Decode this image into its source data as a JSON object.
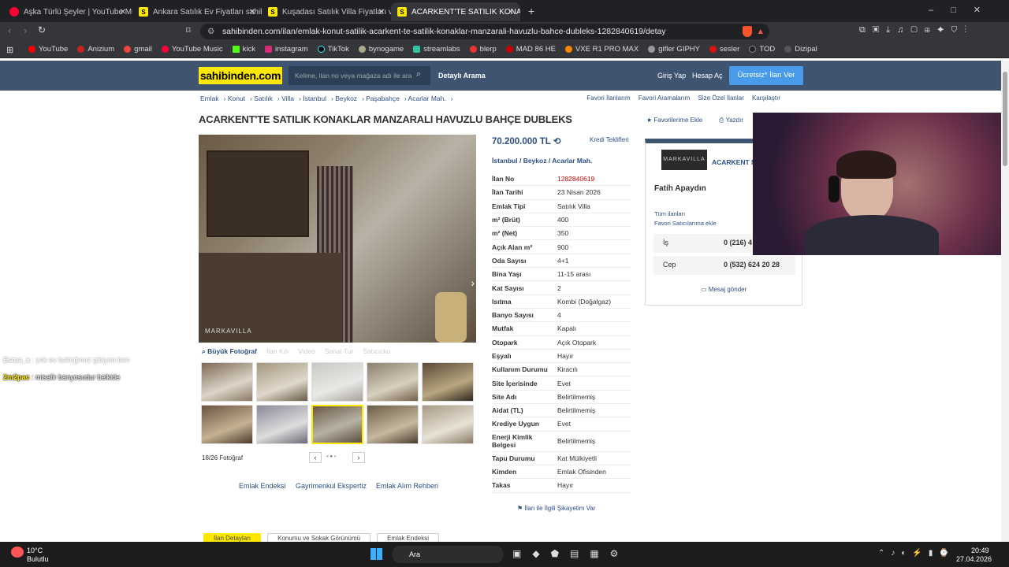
{
  "browser": {
    "tabs": [
      {
        "title": "Aşka Türlü Şeyler | YouTube Music",
        "icon_color": "#ff0033"
      },
      {
        "title": "Ankara Satılık Ev Fiyatları sahibinden.com",
        "icon_color": "#ffe800"
      },
      {
        "title": "Kuşadası Satılık Villa Fiyatları ve Villa",
        "icon_color": "#ffe800"
      },
      {
        "title": "ACARKENT'TE SATILIK KONAKLAR",
        "icon_color": "#ffe800"
      }
    ],
    "url": "sahibinden.com/ilan/emlak-konut-satilik-acarkent-te-satilik-konaklar-manzarali-havuzlu-bahce-dubleks-1282840619/detay",
    "bookmarks": [
      "YouTube",
      "Anizium",
      "gmail",
      "YouTube Music",
      "kick",
      "instagram",
      "TikTok",
      "bynogame",
      "streamlabs",
      "blerp",
      "MAD 86 HE",
      "VXE R1 PRO MAX",
      "gifler GIPHY",
      "sesler",
      "TOD",
      "Dizipal"
    ]
  },
  "site": {
    "logo": "sahibinden.com",
    "search_placeholder": "Kelime, ilan no veya mağaza adı ile ara",
    "detailed_search": "Detaylı Arama",
    "login": "Giriş Yap",
    "register": "Hesap Aç",
    "post_ad": "Ücretsiz* İlan Ver"
  },
  "breadcrumbs": [
    "Emlak",
    "Konut",
    "Satılık",
    "Villa",
    "İstanbul",
    "Beykoz",
    "Paşabahçe",
    "Acarlar Mah."
  ],
  "top_links": [
    "Favori İlanlarım",
    "Favori Aramalarım",
    "Size Özel İlanlar",
    "Karşılaştır"
  ],
  "listing": {
    "title": "ACARKENT'TE SATILIK KONAKLAR MANZARALI HAVUZLU BAHÇE DUBLEKS",
    "favorite": "Favorilerime Ekle",
    "print": "Yazdır",
    "price": "70.200.000 TL",
    "credit": "Kredi Teklifleri",
    "location": [
      "İstanbul",
      "Beykoz",
      "Acarlar Mah."
    ],
    "photo_count": "18/26 Fotoğraf",
    "image_tabs": [
      "Büyük Fotoğraf",
      "İlan Kılı",
      "Video",
      "Sanal Tur",
      "Satıcıcko"
    ],
    "details": [
      {
        "k": "İlan No",
        "v": "1282840619",
        "red": true
      },
      {
        "k": "İlan Tarihi",
        "v": "23 Nisan 2026"
      },
      {
        "k": "Emlak Tipi",
        "v": "Satılık Villa"
      },
      {
        "k": "m² (Brüt)",
        "v": "400"
      },
      {
        "k": "m² (Net)",
        "v": "350"
      },
      {
        "k": "Açık Alan m²",
        "v": "900"
      },
      {
        "k": "Oda Sayısı",
        "v": "4+1"
      },
      {
        "k": "Bina Yaşı",
        "v": "11-15 arası"
      },
      {
        "k": "Kat Sayısı",
        "v": "2"
      },
      {
        "k": "Isıtma",
        "v": "Kombi (Doğalgaz)"
      },
      {
        "k": "Banyo Sayısı",
        "v": "4"
      },
      {
        "k": "Mutfak",
        "v": "Kapalı"
      },
      {
        "k": "Otopark",
        "v": "Açık Otopark"
      },
      {
        "k": "Eşyalı",
        "v": "Hayır"
      },
      {
        "k": "Kullanım Durumu",
        "v": "Kiracılı"
      },
      {
        "k": "Site İçerisinde",
        "v": "Evet"
      },
      {
        "k": "Site Adı",
        "v": "Belirtilmemiş"
      },
      {
        "k": "Aidat (TL)",
        "v": "Belirtilmemiş"
      },
      {
        "k": "Krediye Uygun",
        "v": "Evet"
      },
      {
        "k": "Enerji Kimlik Belgesi",
        "v": "Belirtilmemiş"
      },
      {
        "k": "Tapu Durumu",
        "v": "Kat Mülkiyetli"
      },
      {
        "k": "Kimden",
        "v": "Emlak Ofisinden"
      },
      {
        "k": "Takas",
        "v": "Hayır"
      }
    ],
    "complaint": "İlan ile İlgili Şikayetim Var",
    "bottom_links": [
      "Emlak Endeksi",
      "Gayrimenkul Ekspertiz",
      "Emlak Alım Rehberi"
    ],
    "bottom_tabs": [
      "İlan Detayları",
      "Konumu ve Sokak Görünümü",
      "Emlak Endeksi"
    ]
  },
  "seller": {
    "brand": "MARKAVILLA",
    "store": "ACARKENT M",
    "name": "Fatih Apaydın",
    "all_ads": "Tüm ilanları",
    "fav_seller": "Favori Satıcılarıma ekle",
    "work_label": "İş",
    "work_phone": "0 (216) 4",
    "cell_label": "Cep",
    "cell_phone": "0 (532) 624 20 28",
    "message": "Mesaj gönder"
  },
  "chat": [
    {
      "user": "Esma_x",
      "msg": ": yok ev baktığımız gibiyım ben"
    },
    {
      "user": "2m2pac",
      "msg": ": misafir banyosudur belkide"
    }
  ],
  "taskbar": {
    "temp": "10°C",
    "weather": "Bulutlu",
    "search": "Ara",
    "time": "20:49",
    "date": "27.04.2026"
  }
}
